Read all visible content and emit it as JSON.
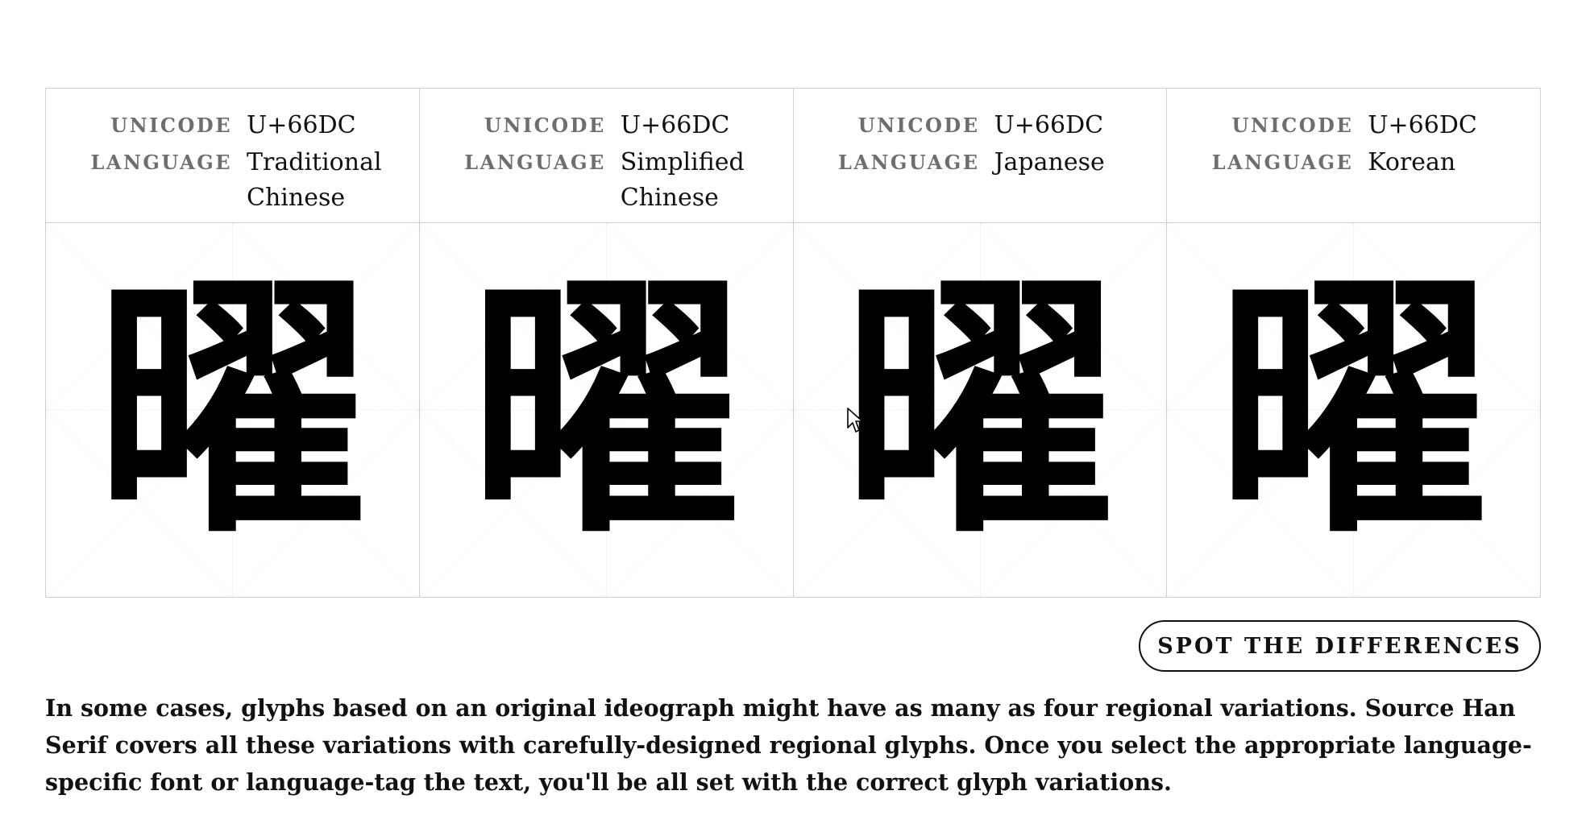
{
  "labels": {
    "unicode": "Unicode",
    "language": "Language"
  },
  "variants": [
    {
      "unicode": "U+66DC",
      "language": "Traditional Chinese",
      "glyph": "曜"
    },
    {
      "unicode": "U+66DC",
      "language": "Simplified Chinese",
      "glyph": "曜"
    },
    {
      "unicode": "U+66DC",
      "language": "Japanese",
      "glyph": "曜"
    },
    {
      "unicode": "U+66DC",
      "language": "Korean",
      "glyph": "曜"
    }
  ],
  "button": {
    "label": "SPOT THE DIFFERENCES"
  },
  "description": "In some cases, glyphs based on an original ideograph might have as many as four regional variations. Source Han Serif covers all these variations with carefully-designed regional glyphs. Once you select the appropriate language-specific font or language-tag the text, you'll be all set with the correct glyph variations.",
  "icons": {
    "cursor": "mouse-pointer-icon"
  },
  "colors": {
    "border": "#cfcfcf",
    "label": "#6e6e6e",
    "text": "#111111",
    "guide": "#c8c8c8"
  }
}
